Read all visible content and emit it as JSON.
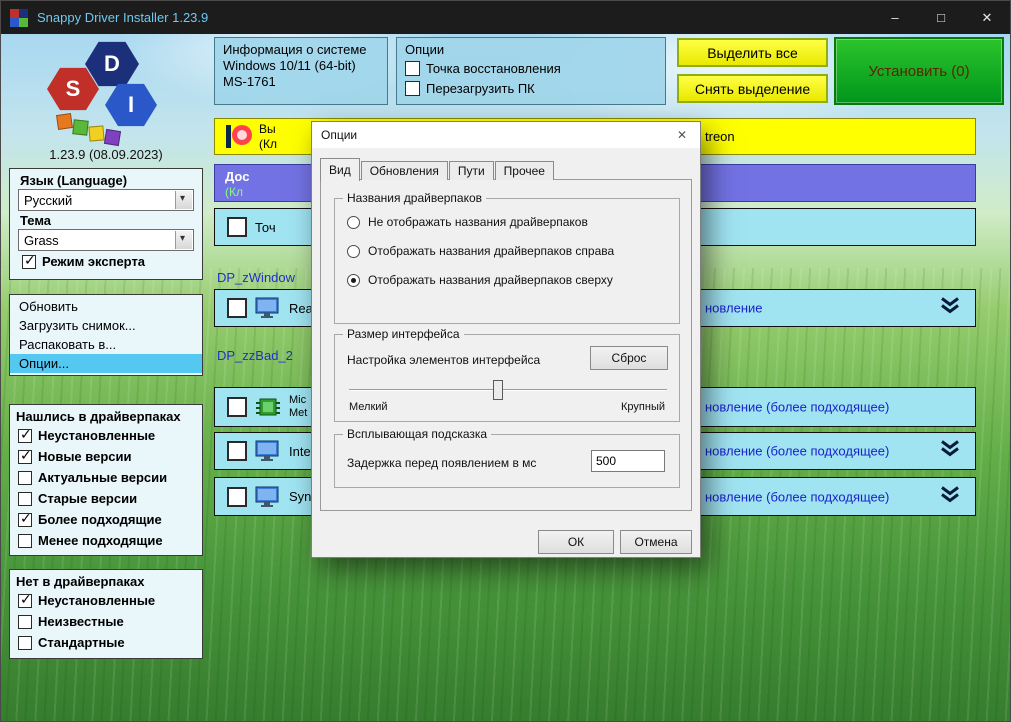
{
  "colors": {
    "title_accent": "#6fc8f0",
    "install_green": "#00961c",
    "action_yellow": "#f2ee00",
    "row_cyan": "#a0e4f2",
    "banner_blue": "#7372e4",
    "banner_yellow": "#ffff00",
    "menu_highlight": "#55c8f2"
  },
  "window": {
    "title": "Snappy Driver Installer 1.23.9",
    "controls": {
      "minimize": "–",
      "maximize": "□",
      "close": "✕"
    }
  },
  "logo": {
    "letters": [
      "S",
      "D",
      "I"
    ],
    "version": "1.23.9 (08.09.2023)"
  },
  "sidebar": {
    "language_label": "Язык (Language)",
    "language_value": "Русский",
    "theme_label": "Тема",
    "theme_value": "Grass",
    "expert_mode": {
      "label": "Режим эксперта",
      "checked": true
    },
    "menu": [
      {
        "label": "Обновить",
        "selected": false
      },
      {
        "label": "Загрузить снимок...",
        "selected": false
      },
      {
        "label": "Распаковать в...",
        "selected": false
      },
      {
        "label": "Опции...",
        "selected": true
      }
    ],
    "filters_found": {
      "title": "Нашлись в драйверпаках",
      "items": [
        {
          "label": "Неустановленные",
          "checked": true
        },
        {
          "label": "Новые версии",
          "checked": true
        },
        {
          "label": "Актуальные версии",
          "checked": false
        },
        {
          "label": "Старые версии",
          "checked": false
        },
        {
          "label": "Более подходящие",
          "checked": true
        },
        {
          "label": "Менее подходящие",
          "checked": false
        }
      ]
    },
    "filters_not_in_packs": {
      "title": "Нет в драйверпаках",
      "items": [
        {
          "label": "Неустановленные",
          "checked": true
        },
        {
          "label": "Неизвестные",
          "checked": false
        },
        {
          "label": "Стандартные",
          "checked": false
        }
      ]
    }
  },
  "topbar": {
    "system_info": {
      "title": "Информация о системе",
      "os": "Windows 10/11 (64-bit)",
      "model": "MS-1761"
    },
    "options_panel": {
      "title": "Опции",
      "restore_point": {
        "label": "Точка восстановления",
        "checked": false
      },
      "reboot": {
        "label": "Перезагрузить ПК",
        "checked": false
      }
    },
    "select_all_label": "Выделить все",
    "deselect_all_label": "Снять выделение",
    "install_label": "Установить (0)"
  },
  "main": {
    "patreon_banner": {
      "left_line1": "Вы",
      "left_line2": "(Кл",
      "right_fragment": "treon"
    },
    "status_banner": {
      "line1": "Дос",
      "line2": "(Кл"
    },
    "group_links": [
      {
        "label": "DP_zWindow"
      },
      {
        "label": "DP_zzBad_2"
      }
    ],
    "rows": [
      {
        "left": "Точ",
        "right": "",
        "checked": false
      },
      {
        "left": "Rea",
        "right": "новление",
        "checked": false
      },
      {
        "left_line1": "Mic",
        "left_line2": "Met",
        "right": "новление (более подходящее)",
        "checked": false
      },
      {
        "left": "Inte",
        "right": "новление (более подходящее)",
        "checked": false
      },
      {
        "left": "Syn",
        "right": "новление (более подходящее)",
        "checked": false
      }
    ]
  },
  "dialog": {
    "title": "Опции",
    "close": "✕",
    "tabs": [
      {
        "label": "Вид",
        "active": true
      },
      {
        "label": "Обновления",
        "active": false
      },
      {
        "label": "Пути",
        "active": false
      },
      {
        "label": "Прочее",
        "active": false
      }
    ],
    "names_group": {
      "title": "Названия драйверпаков",
      "options": [
        {
          "label": "Не отображать названия драйверпаков",
          "selected": false
        },
        {
          "label": "Отображать названия драйверпаков справа",
          "selected": false
        },
        {
          "label": "Отображать названия драйверпаков сверху",
          "selected": true
        }
      ]
    },
    "size_group": {
      "title": "Размер интерфейса",
      "label": "Настройка элементов интерфейса",
      "reset_label": "Сброс",
      "min_label": "Мелкий",
      "max_label": "Крупный"
    },
    "tooltip_group": {
      "title": "Всплывающая подсказка",
      "label": "Задержка перед появлением в мс",
      "delay_value": "500"
    },
    "ok_label": "ОК",
    "cancel_label": "Отмена"
  }
}
